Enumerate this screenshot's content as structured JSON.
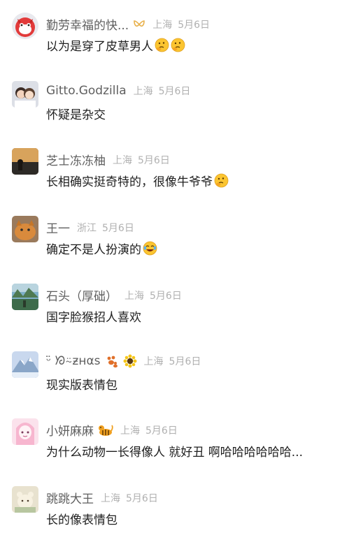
{
  "comments": [
    {
      "name": "勤劳幸福的快...",
      "location": "上海",
      "date": "5月6日",
      "text": "以为是穿了皮草男人",
      "avatar": "red-mascot",
      "badge": "ribbon-icon",
      "trailing_emoji": [
        "thinking-face-icon",
        "thinking-face-icon"
      ]
    },
    {
      "name": "Gitto.Godzilla",
      "location": "上海",
      "date": "5月6日",
      "text": "怀疑是杂交",
      "avatar": "cartoon-couple"
    },
    {
      "name": "芝士冻冻柚",
      "location": "上海",
      "date": "5月6日",
      "text": "长相确实挺奇特的，很像牛爷爷",
      "avatar": "sunset-silhouette",
      "trailing_emoji": [
        "thinking-face-icon"
      ]
    },
    {
      "name": "王一",
      "location": "浙江",
      "date": "5月6日",
      "text": "确定不是人扮演的",
      "avatar": "orange-cat",
      "trailing_emoji": [
        "laughing-crying-icon"
      ]
    },
    {
      "name": "石头（厚础）",
      "location": "上海",
      "date": "5月6日",
      "text": "国字脸猴招人喜欢",
      "avatar": "lake-landscape"
    },
    {
      "name": "ᵕ̈ ᘞ⍨ƶнαѕ",
      "location": "上海",
      "date": "5月6日",
      "text": "现实版表情包",
      "avatar": "snow-mountain",
      "badges": [
        "paw-prints-icon",
        "sunflower-icon"
      ]
    },
    {
      "name": "小妍麻麻",
      "location": "上海",
      "date": "5月6日",
      "text": "为什么动物一长得像人 就好丑 啊哈哈哈哈哈哈...",
      "avatar": "pink-anime-girl",
      "badges": [
        "tiger-icon"
      ]
    },
    {
      "name": "跳跳大王",
      "location": "上海",
      "date": "5月6日",
      "text": "长的像表情包",
      "avatar": "cream-animal"
    }
  ]
}
